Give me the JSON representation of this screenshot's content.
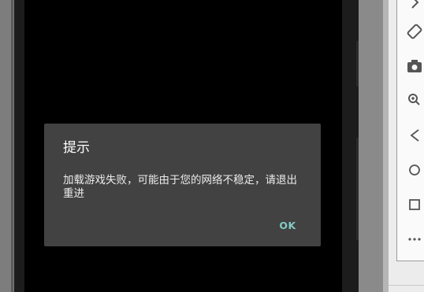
{
  "dialog": {
    "title": "提示",
    "message": "加载游戏失败，可能由于您的网络不稳定，请退出重进",
    "ok_label": "OK"
  },
  "toolbar": {
    "icons": [
      "rotate-left-icon",
      "rotate-right-icon",
      "camera-icon",
      "zoom-icon",
      "back-icon",
      "home-icon",
      "overview-icon",
      "more-icon"
    ]
  },
  "colors": {
    "dialog_bg": "#424242",
    "screen_bg": "#000000",
    "accent": "#80cbc4"
  }
}
